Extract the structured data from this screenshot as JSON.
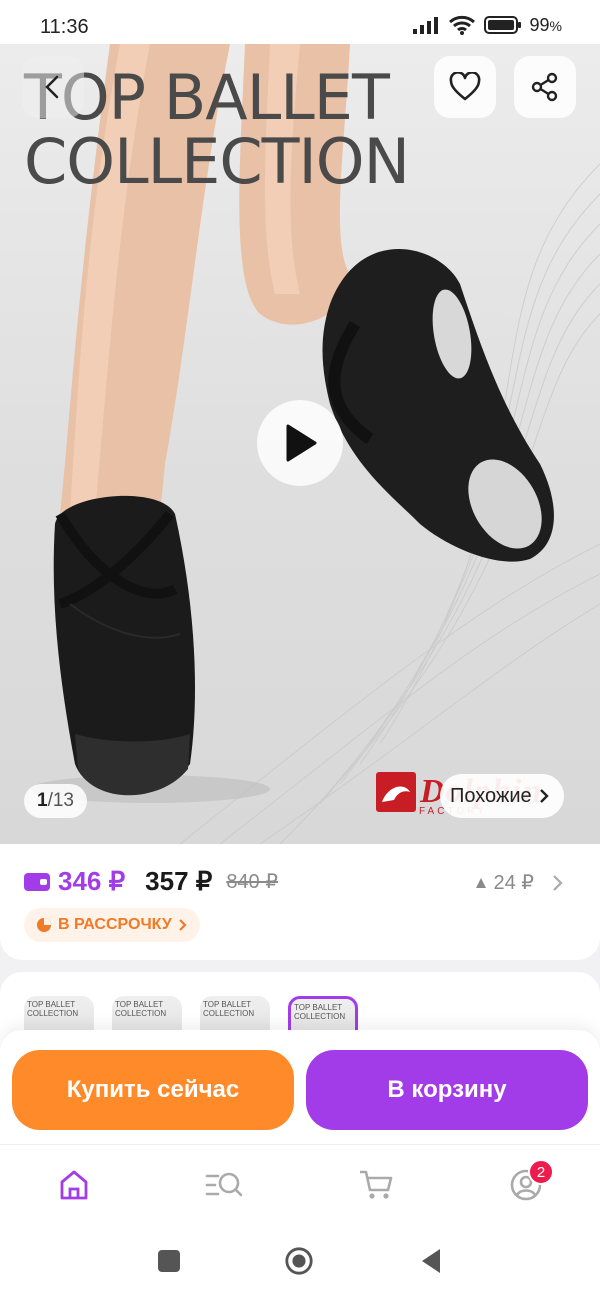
{
  "status_bar": {
    "time": "11:36",
    "battery": "99"
  },
  "product": {
    "image_title_line1": "TOP BALLET",
    "image_title_line2": "COLLECTION",
    "image_index": "1",
    "image_total": "13",
    "brand_logo": "Dolphin",
    "brand_logo_sub": "FACTORY",
    "similar_label": "Похожие"
  },
  "pricing": {
    "wallet_price": "346 ₽",
    "price": "357 ₽",
    "old_price": "840 ₽",
    "price_drop": "24 ₽",
    "installment_label": "В РАССРОЧКУ"
  },
  "thumbnails": [
    {
      "caption": "TOP BALLET COLLECTION",
      "selected": false
    },
    {
      "caption": "TOP BALLET COLLECTION",
      "selected": false
    },
    {
      "caption": "TOP BALLET COLLECTION",
      "selected": false
    },
    {
      "caption": "TOP BALLET COLLECTION",
      "selected": true
    }
  ],
  "actions": {
    "buy_now": "Купить сейчас",
    "add_to_cart": "В корзину"
  },
  "tabbar": {
    "items": [
      {
        "icon": "home-icon",
        "active": true
      },
      {
        "icon": "catalog-search-icon",
        "active": false
      },
      {
        "icon": "cart-icon",
        "active": false
      },
      {
        "icon": "profile-icon",
        "active": false
      }
    ],
    "profile_badge": "2"
  },
  "colors": {
    "accent": "#a23ce8",
    "buy": "#ff8a2a",
    "badge": "#ec1c4c",
    "installment": "#f07a26"
  }
}
